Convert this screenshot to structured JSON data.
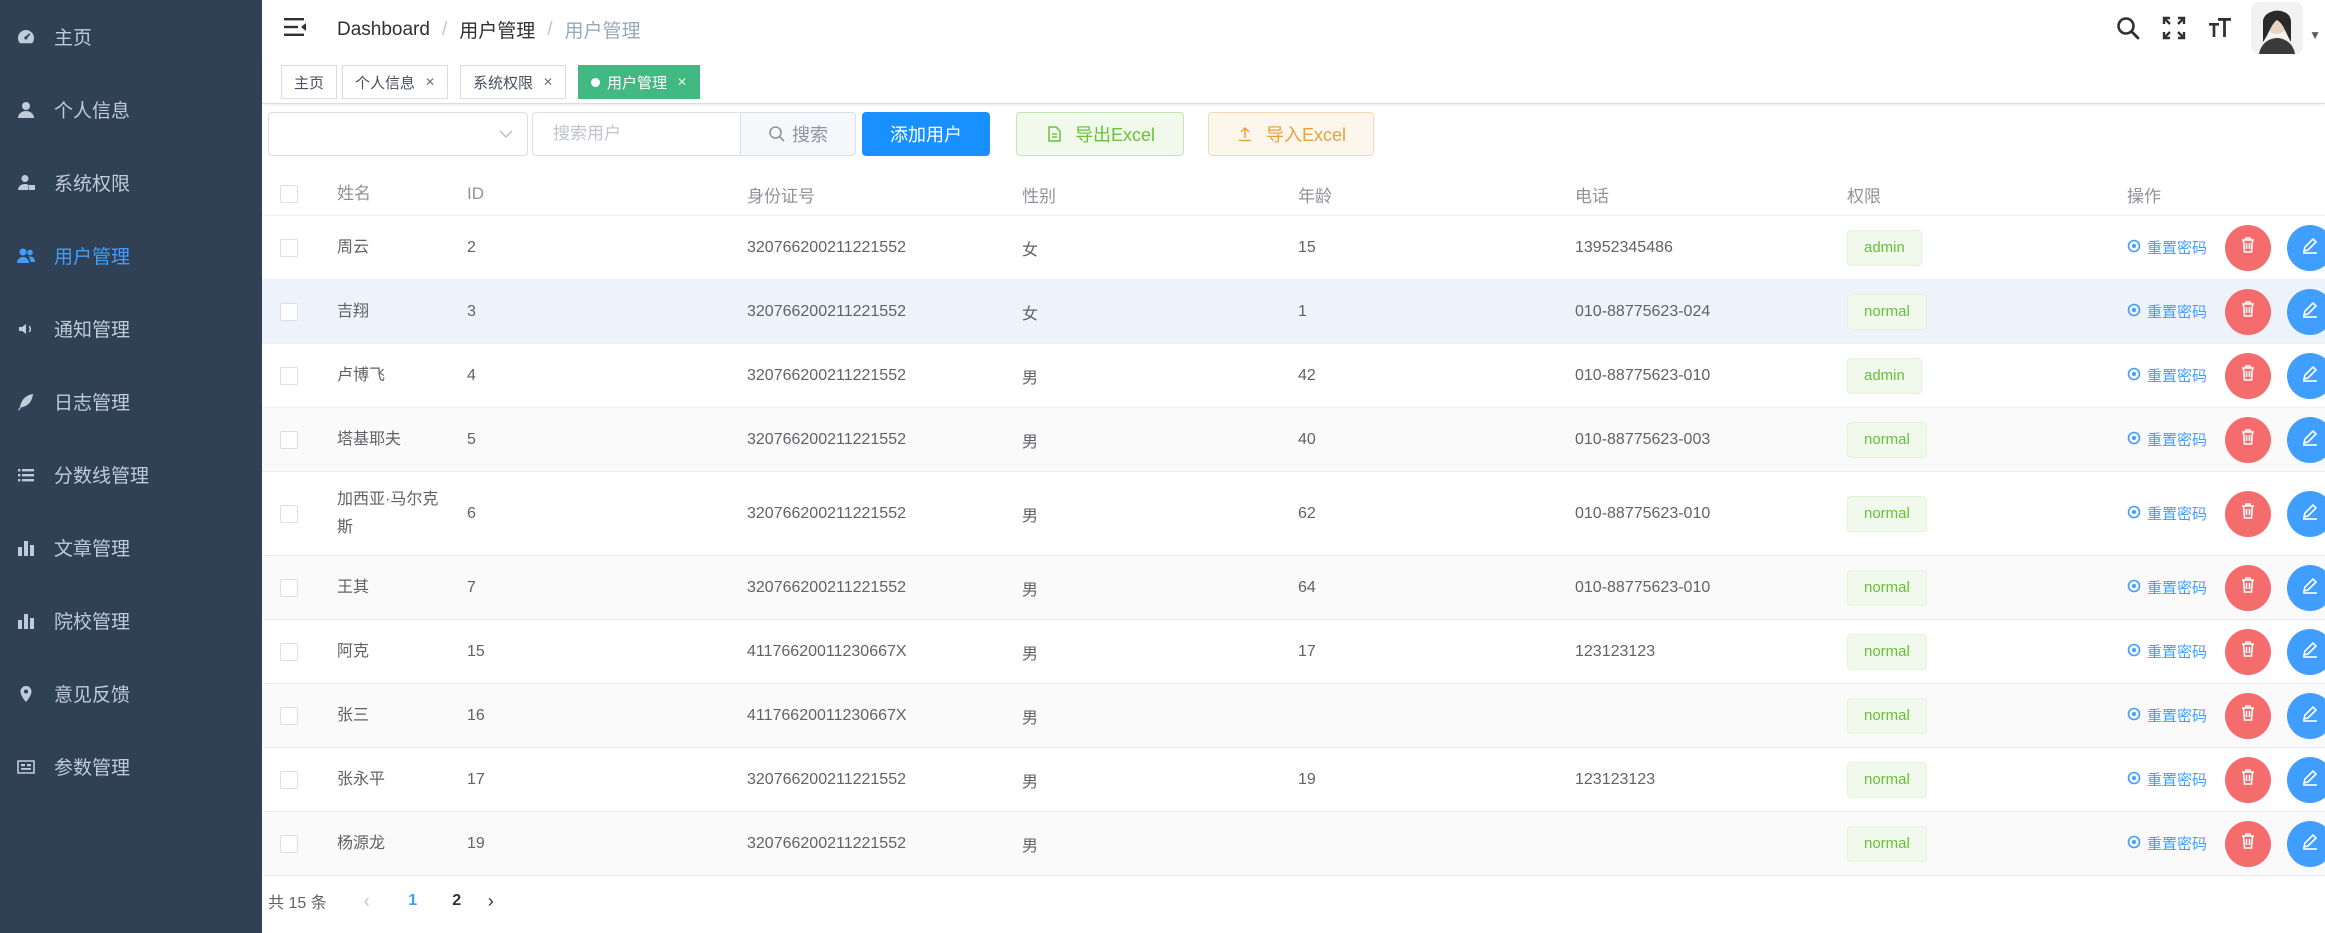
{
  "sidebar": {
    "items": [
      {
        "label": "主页",
        "icon": "dashboard-icon",
        "active": false
      },
      {
        "label": "个人信息",
        "icon": "user-icon",
        "active": false
      },
      {
        "label": "系统权限",
        "icon": "user-lock-icon",
        "active": false
      },
      {
        "label": "用户管理",
        "icon": "users-icon",
        "active": true
      },
      {
        "label": "通知管理",
        "icon": "speaker-icon",
        "active": false
      },
      {
        "label": "日志管理",
        "icon": "feather-icon",
        "active": false
      },
      {
        "label": "分数线管理",
        "icon": "list-icon",
        "active": false
      },
      {
        "label": "文章管理",
        "icon": "bar-chart-icon",
        "active": false
      },
      {
        "label": "院校管理",
        "icon": "bar-chart-icon",
        "active": false
      },
      {
        "label": "意见反馈",
        "icon": "map-pin-icon",
        "active": false
      },
      {
        "label": "参数管理",
        "icon": "settings-panel-icon",
        "active": false
      }
    ],
    "active_color": "#409eff"
  },
  "navbar": {
    "breadcrumb": [
      "Dashboard",
      "用户管理",
      "用户管理"
    ]
  },
  "tags": {
    "home": "主页",
    "profile": "个人信息",
    "permission": "系统权限",
    "users": "用户管理"
  },
  "toolbar": {
    "search_placeholder": "搜索用户",
    "search_label": "搜索",
    "add_label": "添加用户",
    "export_label": "导出Excel",
    "import_label": "导入Excel"
  },
  "table": {
    "headers": {
      "name": "姓名",
      "id": "ID",
      "idcard": "身份证号",
      "sex": "性别",
      "age": "年龄",
      "phone": "电话",
      "role": "权限",
      "op": "操作"
    },
    "reset_label": "重置密码",
    "rows": [
      {
        "name": "周云",
        "id": "2",
        "idcard": "320766200211221552",
        "sex": "女",
        "age": "15",
        "phone": "13952345486",
        "role": "admin"
      },
      {
        "name": "吉翔",
        "id": "3",
        "idcard": "320766200211221552",
        "sex": "女",
        "age": "1",
        "phone": "010-88775623-024",
        "role": "normal"
      },
      {
        "name": "卢博飞",
        "id": "4",
        "idcard": "320766200211221552",
        "sex": "男",
        "age": "42",
        "phone": "010-88775623-010",
        "role": "admin"
      },
      {
        "name": "塔基耶夫",
        "id": "5",
        "idcard": "320766200211221552",
        "sex": "男",
        "age": "40",
        "phone": "010-88775623-003",
        "role": "normal"
      },
      {
        "name": "加西亚·马尔克斯",
        "id": "6",
        "idcard": "320766200211221552",
        "sex": "男",
        "age": "62",
        "phone": "010-88775623-010",
        "role": "normal"
      },
      {
        "name": "王其",
        "id": "7",
        "idcard": "320766200211221552",
        "sex": "男",
        "age": "64",
        "phone": "010-88775623-010",
        "role": "normal"
      },
      {
        "name": "阿克",
        "id": "15",
        "idcard": "41176620011230667X",
        "sex": "男",
        "age": "17",
        "phone": "123123123",
        "role": "normal"
      },
      {
        "name": "张三",
        "id": "16",
        "idcard": "41176620011230667X",
        "sex": "男",
        "age": "",
        "phone": "",
        "role": "normal"
      },
      {
        "name": "张永平",
        "id": "17",
        "idcard": "320766200211221552",
        "sex": "男",
        "age": "19",
        "phone": "123123123",
        "role": "normal"
      },
      {
        "name": "杨源龙",
        "id": "19",
        "idcard": "320766200211221552",
        "sex": "男",
        "age": "",
        "phone": "",
        "role": "normal"
      }
    ]
  },
  "pagination": {
    "total": "共 15 条",
    "pages": [
      "1",
      "2"
    ],
    "current": "1"
  }
}
